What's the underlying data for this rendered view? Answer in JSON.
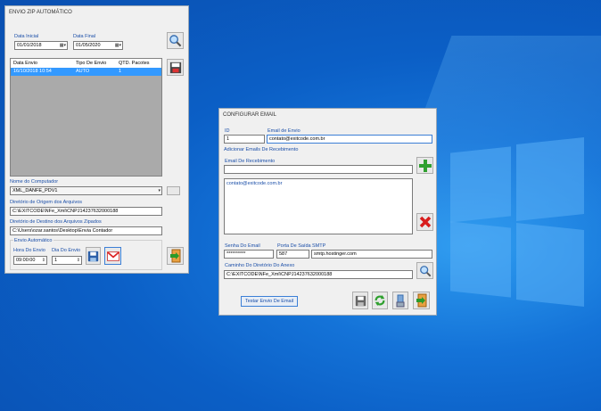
{
  "envio_zip": {
    "title": "ENVIO ZIP AUTOMÁTICO",
    "data_inicial_label": "Data Inicial",
    "data_inicial_value": "01/01/2018",
    "data_final_label": "Data Final",
    "data_final_value": "01/05/2020",
    "table": {
      "headers": [
        "Data Envio",
        "Tipo De Envio",
        "QTD. Pacotes"
      ],
      "rows": [
        [
          "16/10/2018 10:54",
          "AUTO",
          "1"
        ]
      ]
    },
    "nome_computador_label": "Nome do Computador",
    "nome_computador_value": "XML_DANFE_PDV1",
    "origem_label": "Diretório de Origem dos Arquivos",
    "origem_value": "C:\\EXITCODE\\NFe_Xml\\CNPJ14237632000188",
    "destino_label": "Diretório de Destino dos Arquivos Zipados",
    "destino_value": "C:\\Users\\ozar.santos\\Desktop\\Envia Contador",
    "envio_auto_label": "Envio Automático",
    "hora_label": "Hora Do Envio",
    "hora_value": "09:00:00",
    "dia_label": "Dia Do Envio",
    "dia_value": "1"
  },
  "config_email": {
    "title": "CONFIGURAR EMAIL",
    "id_label": "ID",
    "id_value": "1",
    "email_envio_label": "Email de Envio",
    "email_envio_value": "contato@exitcode.com.br",
    "adicionar_label": "Adicionar Emails De Recebimento",
    "email_receb_label": "Email De Recebimento",
    "email_receb_value": "",
    "list_items": [
      "contato@exitcode.com.br"
    ],
    "senha_label": "Senha Do Email",
    "senha_value": "**********",
    "porta_label": "Porta De Saída",
    "porta_value": "587",
    "smtp_label": "SMTP",
    "smtp_value": "smtp.hostinger.com",
    "caminho_label": "Caminho Do Diretório Do Anexo",
    "caminho_value": "C:\\EXITCODE\\NFe_Xml\\CNPJ14237632000188",
    "testar_label": "Testar Envio De Email"
  },
  "colors": {
    "accent": "#3399ff",
    "label": "#1a4ea8",
    "add": "#2fa02f",
    "delete": "#d81c1c"
  }
}
